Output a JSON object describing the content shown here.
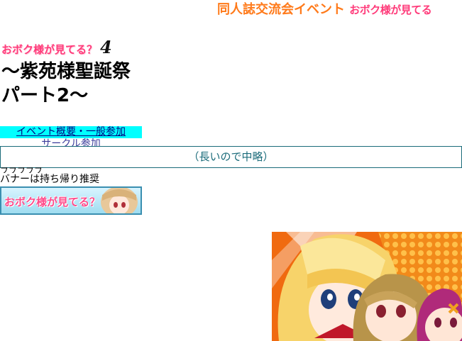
{
  "header": {
    "title": "同人誌交流会イベント",
    "logo_text": "おボク様が見てる"
  },
  "event": {
    "logo_text": "おボク様が見てる？",
    "number": "4",
    "subtitle": "～紫苑様聖誕祭　パート2～"
  },
  "nav": {
    "items": [
      {
        "label": "イベント概要・一般参加"
      },
      {
        "label": "サークル参加"
      }
    ]
  },
  "content": {
    "omitted_text": "（長いので中略）",
    "cutoff_text": "ブブブブブ",
    "banner_note": "バナーは持ち帰り推奨",
    "banner_text": "おボク様が見てる？"
  },
  "colors": {
    "header_orange": "#ff7a1a",
    "logo_pink": "#ff3b7a",
    "nav_highlight": "#00ffff",
    "link": "#000080",
    "border_teal": "#1a6b7a"
  }
}
